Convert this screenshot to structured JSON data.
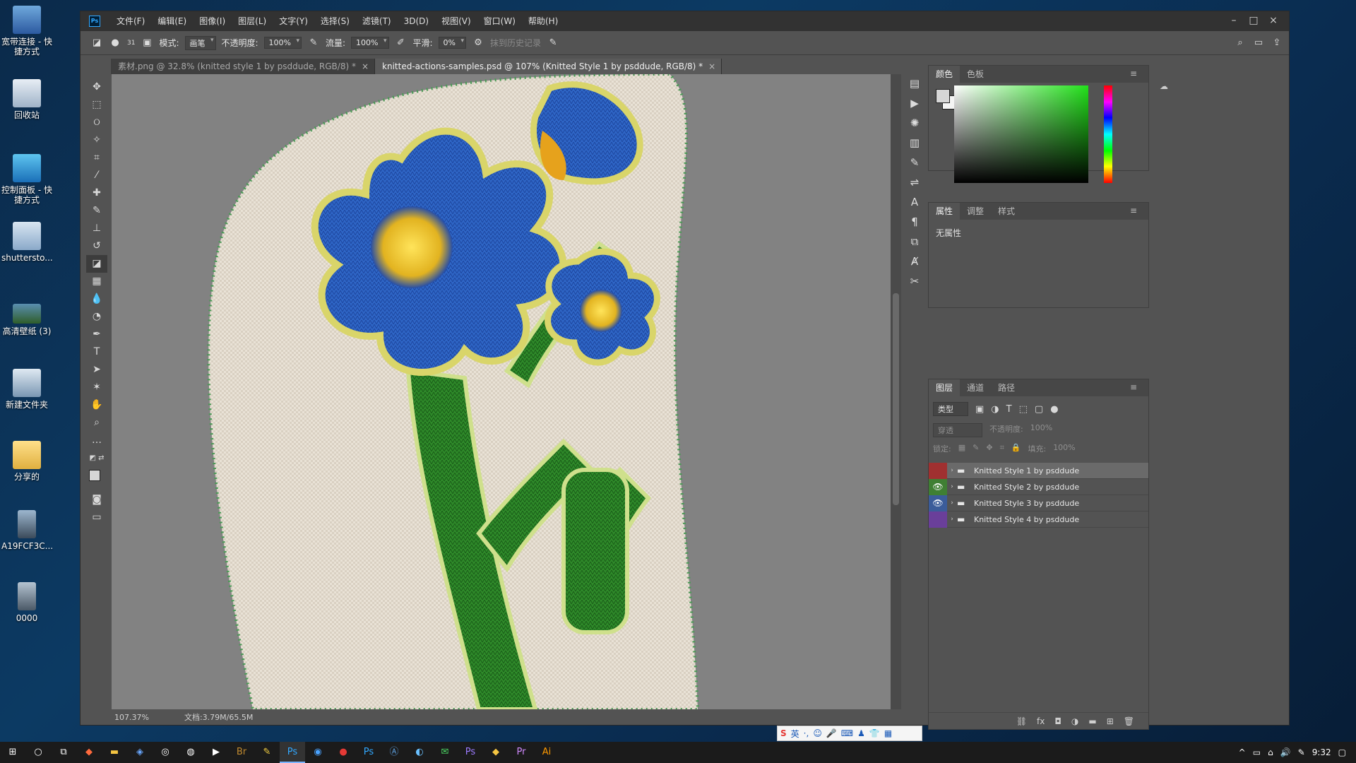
{
  "desktop": {
    "icons": [
      {
        "label": "宽带连接 - 快捷方式"
      },
      {
        "label": "回收站"
      },
      {
        "label": "控制面板 - 快捷方式"
      },
      {
        "label": "shuttersto..."
      },
      {
        "label": "高清壁纸 (3)"
      },
      {
        "label": "新建文件夹"
      },
      {
        "label": "分享的"
      },
      {
        "label": "A19FCF3C..."
      },
      {
        "label": "0000"
      }
    ]
  },
  "app": {
    "logo": "Ps",
    "menu": [
      "文件(F)",
      "编辑(E)",
      "图像(I)",
      "图层(L)",
      "文字(Y)",
      "选择(S)",
      "滤镜(T)",
      "3D(D)",
      "视图(V)",
      "窗口(W)",
      "帮助(H)"
    ],
    "window_controls": {
      "minimize": "–",
      "maximize": "□",
      "close": "×"
    }
  },
  "options_bar": {
    "brush_size": "31",
    "mode_label": "模式:",
    "mode_value": "画笔",
    "opacity_label": "不透明度:",
    "opacity_value": "100%",
    "flow_label": "流量:",
    "flow_value": "100%",
    "smoothing_label": "平滑:",
    "smoothing_value": "0%",
    "history_label": "抹到历史记录"
  },
  "tabs": [
    {
      "title": "素材.png @ 32.8% (knitted style 1 by psddude, RGB/8) *",
      "active": false
    },
    {
      "title": "knitted-actions-samples.psd @ 107% (Knitted Style 1 by psddude, RGB/8) *",
      "active": true
    }
  ],
  "status": {
    "zoom": "107.37%",
    "doc": "文档:3.79M/65.5M"
  },
  "panels": {
    "color": {
      "tabs": [
        "颜色",
        "色板"
      ],
      "fg": "#d6d6d6",
      "bg": "#f4f4f4",
      "hue": "#22e01a"
    },
    "properties": {
      "tabs": [
        "属性",
        "调整",
        "样式"
      ],
      "body": "无属性"
    },
    "layers": {
      "tabs": [
        "图层",
        "通道",
        "路径"
      ],
      "filter_label": "类型",
      "blend_mode": "穿透",
      "opacity_label": "不透明度:",
      "opacity_value": "100%",
      "lock_label": "锁定:",
      "fill_label": "填充:",
      "fill_value": "100%",
      "items": [
        {
          "name": "Knitted Style 1 by psddude",
          "color": "#a03030",
          "visible": false,
          "selected": true
        },
        {
          "name": "Knitted Style 2 by psddude",
          "color": "#3f7f33",
          "visible": true,
          "selected": false
        },
        {
          "name": "Knitted Style 3 by psddude",
          "color": "#3b5c9a",
          "visible": true,
          "selected": false
        },
        {
          "name": "Knitted Style 4 by psddude",
          "color": "#6a3f9a",
          "visible": false,
          "selected": false
        }
      ]
    }
  },
  "ime": {
    "mode": "英"
  },
  "taskbar": {
    "time": "9:32"
  }
}
